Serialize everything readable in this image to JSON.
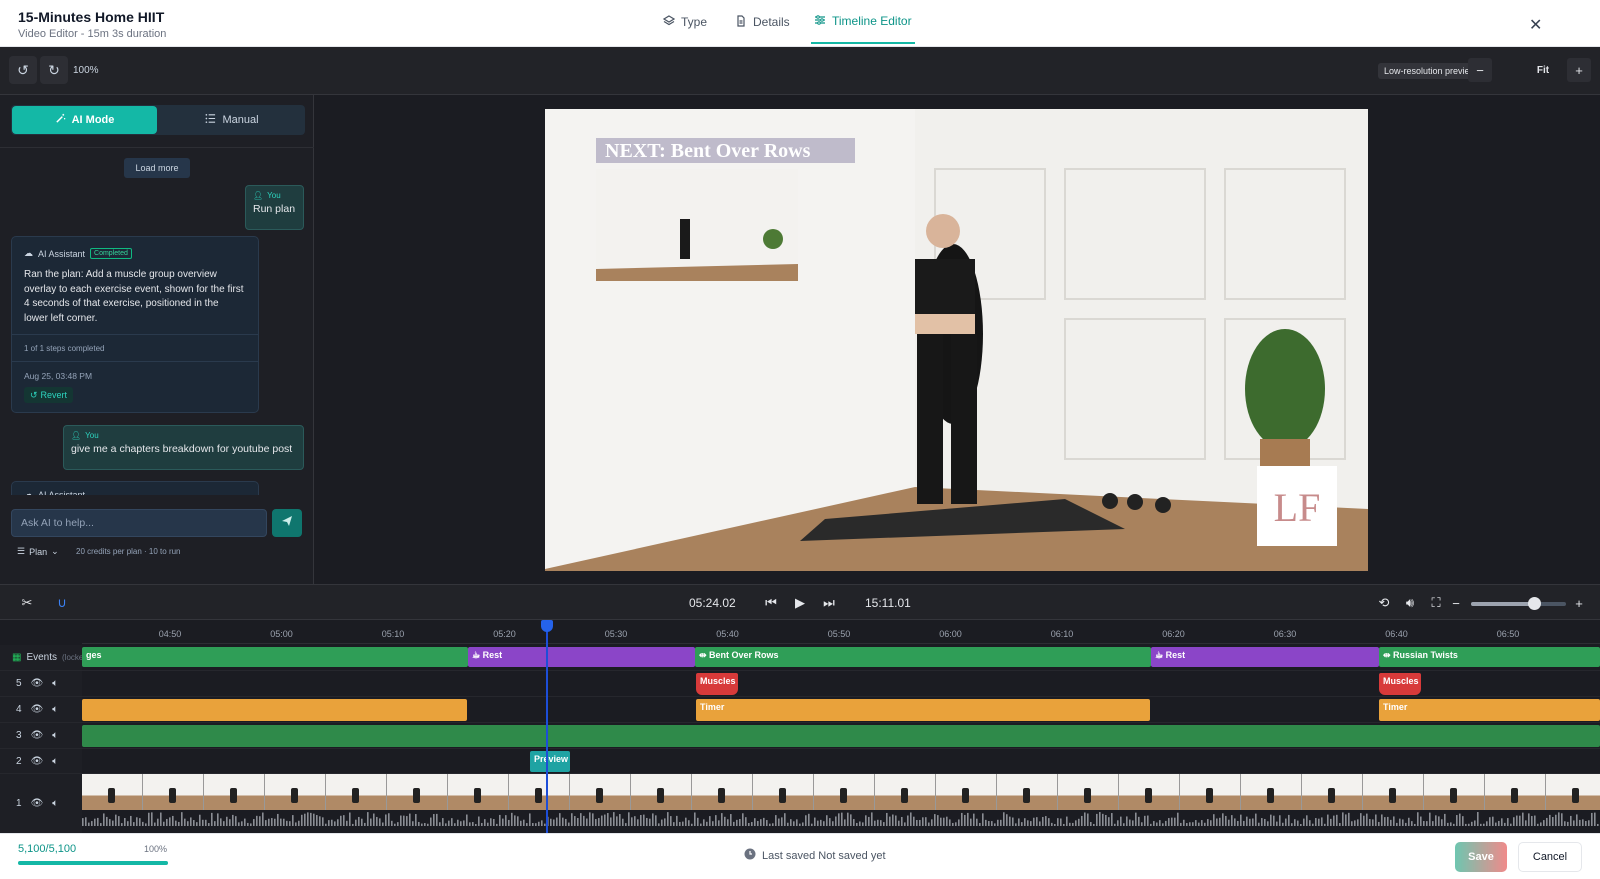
{
  "header": {
    "title": "15-Minutes Home HIIT",
    "subtitle": "Video Editor - 15m 3s duration",
    "tabs": [
      {
        "label": "Type",
        "active": false
      },
      {
        "label": "Details",
        "active": false
      },
      {
        "label": "Timeline Editor",
        "active": true
      }
    ],
    "accent": "#14b8a6"
  },
  "toolbar": {
    "zoom": "100%",
    "lowres_label": "Low-resolution preview",
    "fit_label": "Fit"
  },
  "panel": {
    "ai_mode_label": "AI Mode",
    "manual_label": "Manual",
    "load_more": "Load more",
    "messages": [
      {
        "role": "You",
        "text": "Run plan"
      },
      {
        "role": "AI Assistant",
        "badge": "Completed",
        "text": "Ran the plan: Add a muscle group overview overlay to each exercise event, shown for the first 4 seconds of that exercise, positioned in the lower left corner.",
        "steps": "1 of 1 steps completed",
        "date": "Aug 25, 03:48 PM",
        "revert": "Revert"
      },
      {
        "role": "You",
        "text": "give me a chapters breakdown for youtube post"
      },
      {
        "role": "AI Assistant"
      }
    ],
    "input_placeholder": "Ask AI to help...",
    "plan_label": "Plan",
    "credits": "20 credits per plan · 10 to run"
  },
  "preview": {
    "overlay_text": "NEXT: Bent Over Rows"
  },
  "controls": {
    "current_time": "05:24.02",
    "duration": "15:11.01",
    "volume_fraction": 0.66
  },
  "timeline": {
    "ticks": [
      "04:50",
      "05:00",
      "05:10",
      "05:20",
      "05:30",
      "05:40",
      "05:50",
      "06:00",
      "06:10",
      "06:20",
      "06:30",
      "06:40",
      "06:50"
    ],
    "events_label": "Events",
    "events_hint": "(locke",
    "event_clips": [
      {
        "label": "ges",
        "color": "#2f9e57"
      },
      {
        "label": "Rest",
        "color": "#8b45c8"
      },
      {
        "label": "Bent Over Rows",
        "color": "#2f9e57"
      },
      {
        "label": "Rest",
        "color": "#8b45c8"
      },
      {
        "label": "Russian Twists",
        "color": "#2f9e57"
      }
    ],
    "tracks": [
      "5",
      "4",
      "3",
      "2",
      "1"
    ],
    "clip_muscles": "Muscles",
    "clip_timer": "Timer",
    "clip_preview": "Preview",
    "colors": {
      "timer": "#e9a23b",
      "muscles": "#d83a3a",
      "green": "#2f8a4a",
      "preview": "#1fa3a3"
    }
  },
  "footer": {
    "usage": "5,100/5,100",
    "usage_pct": "100%",
    "usage_fraction": 1.0,
    "saved_status": "Last saved Not saved yet",
    "save_label": "Save",
    "cancel_label": "Cancel"
  }
}
